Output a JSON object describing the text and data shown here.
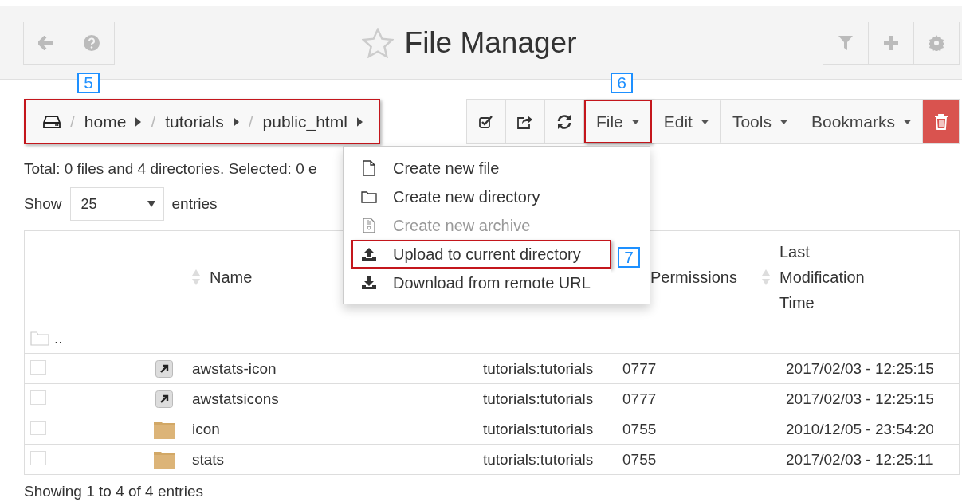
{
  "header": {
    "title": "File Manager",
    "favorite": false
  },
  "breadcrumb": {
    "highlighted": true,
    "callout": "5",
    "separator": "/",
    "items": [
      "home",
      "tutorials",
      "public_html"
    ]
  },
  "toolbar": {
    "menus": [
      {
        "label": "File",
        "highlighted": true,
        "callout": "6"
      },
      {
        "label": "Edit",
        "highlighted": false
      },
      {
        "label": "Tools",
        "highlighted": false
      },
      {
        "label": "Bookmarks",
        "highlighted": false
      }
    ]
  },
  "file_menu": {
    "open": true,
    "items": [
      {
        "kind": "file",
        "label": "Create new file",
        "disabled": false,
        "highlighted": false
      },
      {
        "kind": "folder",
        "label": "Create new directory",
        "disabled": false,
        "highlighted": false
      },
      {
        "kind": "archive",
        "label": "Create new archive",
        "disabled": true,
        "highlighted": false
      },
      {
        "kind": "upload",
        "label": "Upload to current directory",
        "disabled": false,
        "highlighted": true,
        "callout": "7"
      },
      {
        "kind": "download",
        "label": "Download from remote URL",
        "disabled": false,
        "highlighted": false
      }
    ]
  },
  "summary": "Total: 0 files and 4 directories. Selected: 0 e",
  "page_size": {
    "label": "Show",
    "value": "25",
    "suffix": "entries"
  },
  "table": {
    "headers": {
      "name": "Name",
      "permissions": "Permissions",
      "modified": "Last Modification Time"
    },
    "parent": "..",
    "rows": [
      {
        "kind": "link",
        "checked": false,
        "name": "awstats-icon",
        "owner": "tutorials:tutorials",
        "permissions": "0777",
        "modified": "2017/02/03 - 12:25:15"
      },
      {
        "kind": "link",
        "checked": false,
        "name": "awstatsicons",
        "owner": "tutorials:tutorials",
        "permissions": "0777",
        "modified": "2017/02/03 - 12:25:15"
      },
      {
        "kind": "folder",
        "checked": false,
        "name": "icon",
        "owner": "tutorials:tutorials",
        "permissions": "0755",
        "modified": "2010/12/05 - 23:54:20"
      },
      {
        "kind": "folder",
        "checked": false,
        "name": "stats",
        "owner": "tutorials:tutorials",
        "permissions": "0755",
        "modified": "2017/02/03 - 12:25:11"
      }
    ]
  },
  "footer": "Showing 1 to 4 of 4 entries"
}
